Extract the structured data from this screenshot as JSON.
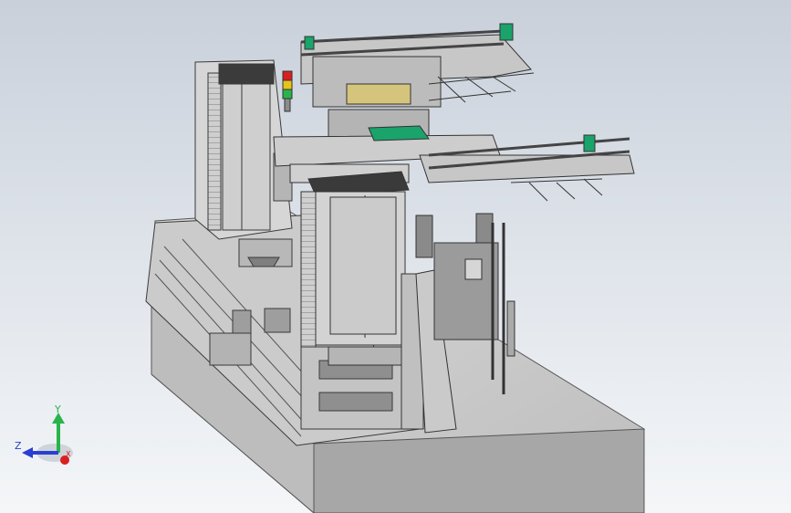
{
  "viewport": {
    "background_top": "#c9d0da",
    "background_bottom": "#f4f6f8",
    "model_body_color": "#bfbfbf",
    "model_edge_color": "#4a4a4a",
    "accent_green": "#1aa36b"
  },
  "triad": {
    "y_label": "Y",
    "z_label": "Z",
    "x_label": "X",
    "y_color": "#28b44a",
    "z_color": "#2a3fd1",
    "x_color": "#d92020"
  },
  "signal_tower": {
    "colors": [
      "#d92020",
      "#e8c21a",
      "#28b44a"
    ]
  }
}
